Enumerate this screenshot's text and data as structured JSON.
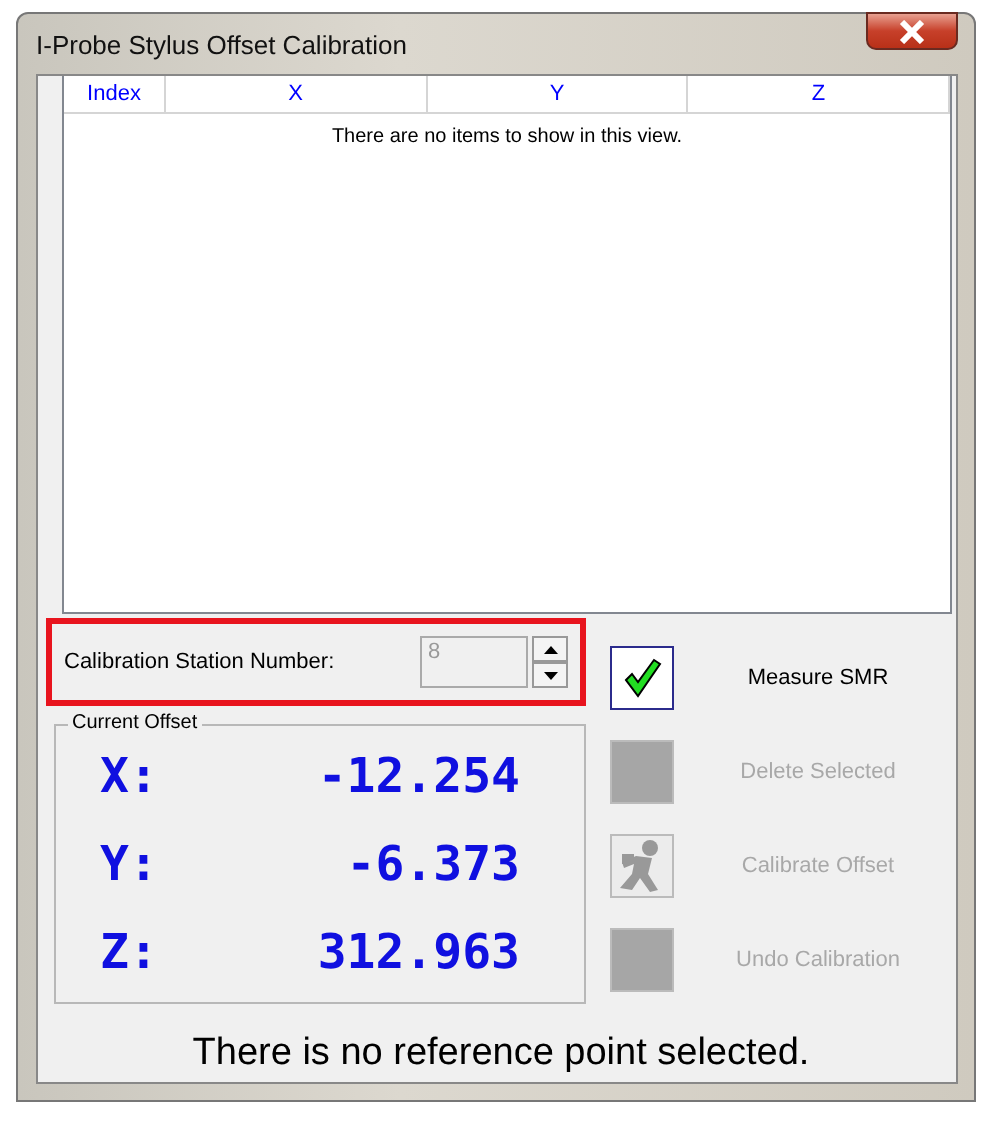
{
  "window": {
    "title": "I-Probe Stylus Offset Calibration"
  },
  "table": {
    "columns": [
      "Index",
      "X",
      "Y",
      "Z"
    ],
    "empty_message": "There are no items to show in this view."
  },
  "station": {
    "label": "Calibration Station Number:",
    "value": "8",
    "disabled": true,
    "highlighted": true
  },
  "current_offset": {
    "title": "Current Offset",
    "rows": [
      {
        "axis": "X:",
        "value": "-12.254"
      },
      {
        "axis": "Y:",
        "value": "-6.373"
      },
      {
        "axis": "Z:",
        "value": "312.963"
      }
    ]
  },
  "actions": [
    {
      "kind": "check",
      "label": "Measure SMR",
      "disabled": false
    },
    {
      "kind": "blank",
      "label": "Delete Selected",
      "disabled": true
    },
    {
      "kind": "runner",
      "label": "Calibrate Offset",
      "disabled": true
    },
    {
      "kind": "blank",
      "label": "Undo Calibration",
      "disabled": true
    }
  ],
  "status": "There is no reference point selected."
}
